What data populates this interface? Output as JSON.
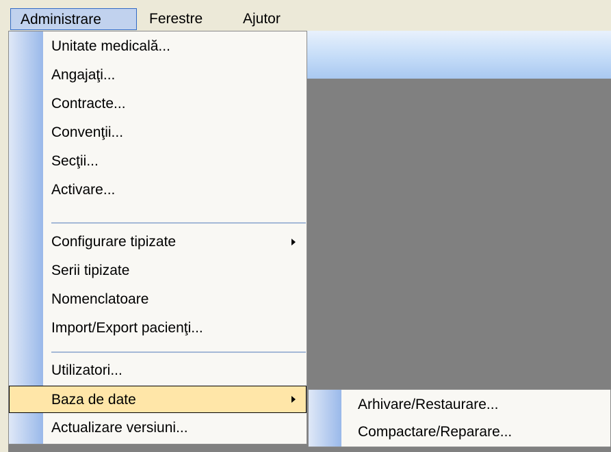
{
  "menubar": {
    "items": [
      {
        "label": "Administrare"
      },
      {
        "label": "Ferestre"
      },
      {
        "label": "Ajutor"
      }
    ]
  },
  "admin_menu": {
    "items": [
      {
        "label": "Unitate medicală..."
      },
      {
        "label": "Angajaţi..."
      },
      {
        "label": "Contracte..."
      },
      {
        "label": "Convenţii..."
      },
      {
        "label": "Secţii..."
      },
      {
        "label": "Activare..."
      },
      {
        "label": "Configurare tipizate"
      },
      {
        "label": "Serii tipizate"
      },
      {
        "label": "Nomenclatoare"
      },
      {
        "label": "Import/Export pacienţi..."
      },
      {
        "label": "Utilizatori..."
      },
      {
        "label": "Baza de date"
      },
      {
        "label": "Actualizare versiuni..."
      }
    ]
  },
  "submenu": {
    "items": [
      {
        "label": "Arhivare/Restaurare..."
      },
      {
        "label": "Compactare/Reparare..."
      }
    ]
  },
  "colors": {
    "menubar_bg": "#ece9d8",
    "menu_bg": "#f9f8f4",
    "hover_bg": "#ffe6a8",
    "workspace_bg": "#808080",
    "active_menubar_bg": "#c1d2ee"
  }
}
